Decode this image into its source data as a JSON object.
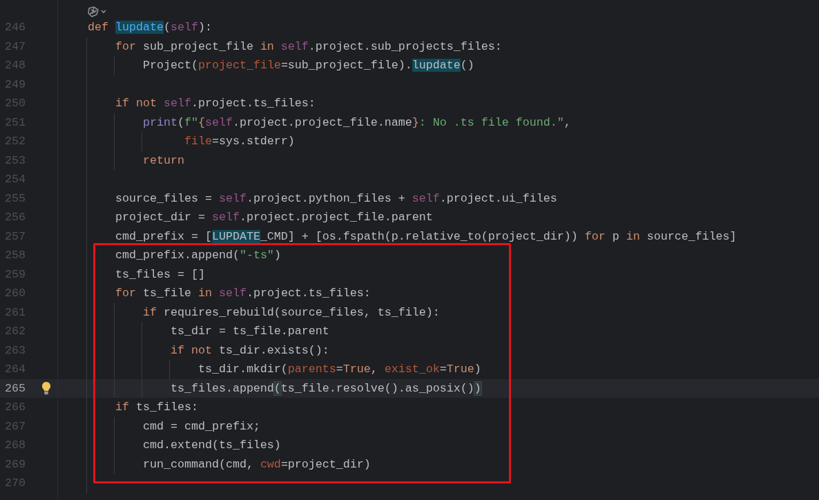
{
  "editor": {
    "lines": [
      {
        "number": "246",
        "current": false,
        "bulb": false,
        "tokens": [
          {
            "text": "    def",
            "kind": "keyword"
          },
          {
            "text": " lupdate",
            "kind": "function",
            "highlighted": true
          },
          {
            "text": "("
          },
          {
            "text": "self",
            "kind": "self"
          },
          {
            "text": "):"
          }
        ]
      },
      {
        "number": "247",
        "current": false,
        "bulb": false,
        "tokens": [
          {
            "text": "        for",
            "kind": "keyword"
          },
          {
            "text": " sub_project_file "
          },
          {
            "text": "in",
            "kind": "keyword"
          },
          {
            "text": " self",
            "kind": "self"
          },
          {
            "text": ".project.sub_projects_files:"
          }
        ]
      },
      {
        "number": "248",
        "current": false,
        "bulb": false,
        "tokens": [
          {
            "text": "            Project("
          },
          {
            "text": "project_file",
            "kind": "param"
          },
          {
            "text": "=sub_project_file)."
          },
          {
            "text": "lupdate",
            "highlighted": true
          },
          {
            "text": "()"
          }
        ]
      },
      {
        "number": "249",
        "current": false,
        "bulb": false
      },
      {
        "number": "250",
        "current": false,
        "bulb": false,
        "tokens": [
          {
            "text": "        if not",
            "kind": "keyword"
          },
          {
            "text": " self",
            "kind": "self"
          },
          {
            "text": ".project.ts_files:"
          }
        ]
      },
      {
        "number": "251",
        "current": false,
        "bulb": false,
        "tokens": [
          {
            "text": "            print",
            "kind": "builtin"
          },
          {
            "text": "("
          },
          {
            "text": "f\"",
            "kind": "string"
          },
          {
            "text": "{",
            "kind": "keyword"
          },
          {
            "text": "self",
            "kind": "self"
          },
          {
            "text": ".project.project_file.name"
          },
          {
            "text": "}",
            "kind": "keyword"
          },
          {
            "text": ": No .ts file found.\"",
            "kind": "string"
          },
          {
            "text": ","
          }
        ]
      },
      {
        "number": "252",
        "current": false,
        "bulb": false,
        "tokens": [
          {
            "text": "                  file",
            "kind": "param"
          },
          {
            "text": "=sys.stderr)"
          }
        ]
      },
      {
        "number": "253",
        "current": false,
        "bulb": false,
        "tokens": [
          {
            "text": "            return",
            "kind": "keyword"
          }
        ]
      },
      {
        "number": "254",
        "current": false,
        "bulb": false
      },
      {
        "number": "255",
        "current": false,
        "bulb": false,
        "tokens": [
          {
            "text": "        source_files = "
          },
          {
            "text": "self",
            "kind": "self"
          },
          {
            "text": ".project.python_files + "
          },
          {
            "text": "self",
            "kind": "self"
          },
          {
            "text": ".project.ui_files"
          }
        ]
      },
      {
        "number": "256",
        "current": false,
        "bulb": false,
        "tokens": [
          {
            "text": "        project_dir = "
          },
          {
            "text": "self",
            "kind": "self"
          },
          {
            "text": ".project.project_file.parent"
          }
        ]
      },
      {
        "number": "257",
        "current": false,
        "bulb": false,
        "tokens": [
          {
            "text": "        cmd_prefix = ["
          },
          {
            "text": "LUPDATE",
            "highlighted": true
          },
          {
            "text": "_CMD] + [os.fspath(p.relative_to(project_dir)) "
          },
          {
            "text": "for",
            "kind": "keyword"
          },
          {
            "text": " p "
          },
          {
            "text": "in",
            "kind": "keyword"
          },
          {
            "text": " source_files]"
          }
        ]
      },
      {
        "number": "258",
        "current": false,
        "bulb": false,
        "tokens": [
          {
            "text": "        cmd_prefix.append("
          },
          {
            "text": "\"-ts\"",
            "kind": "string"
          },
          {
            "text": ")"
          }
        ]
      },
      {
        "number": "259",
        "current": false,
        "bulb": false,
        "tokens": [
          {
            "text": "        ts_files = []"
          }
        ]
      },
      {
        "number": "260",
        "current": false,
        "bulb": false,
        "tokens": [
          {
            "text": "        for",
            "kind": "keyword"
          },
          {
            "text": " ts_file "
          },
          {
            "text": "in",
            "kind": "keyword"
          },
          {
            "text": " self",
            "kind": "self"
          },
          {
            "text": ".project.ts_files:"
          }
        ]
      },
      {
        "number": "261",
        "current": false,
        "bulb": false,
        "tokens": [
          {
            "text": "            if",
            "kind": "keyword"
          },
          {
            "text": " requires_rebuild(source_files, ts_file):"
          }
        ]
      },
      {
        "number": "262",
        "current": false,
        "bulb": false,
        "tokens": [
          {
            "text": "                ts_dir = ts_file.parent"
          }
        ]
      },
      {
        "number": "263",
        "current": false,
        "bulb": false,
        "tokens": [
          {
            "text": "                if not",
            "kind": "keyword"
          },
          {
            "text": " ts_dir.exists():"
          }
        ]
      },
      {
        "number": "264",
        "current": false,
        "bulb": false,
        "tokens": [
          {
            "text": "                    ts_dir.mkdir("
          },
          {
            "text": "parents",
            "kind": "param"
          },
          {
            "text": "="
          },
          {
            "text": "True",
            "kind": "keyword"
          },
          {
            "text": ", "
          },
          {
            "text": "exist_ok",
            "kind": "param"
          },
          {
            "text": "="
          },
          {
            "text": "True",
            "kind": "keyword"
          },
          {
            "text": ")"
          }
        ]
      },
      {
        "number": "265",
        "current": true,
        "bulb": true,
        "tokens": [
          {
            "text": "                ts_files.append"
          },
          {
            "text": "(",
            "kind": "brace",
            "highlighted": true
          },
          {
            "text": "ts_file.resolve().as_posix()"
          },
          {
            "text": ")",
            "kind": "brace",
            "highlighted": true
          }
        ]
      },
      {
        "number": "266",
        "current": false,
        "bulb": false,
        "tokens": [
          {
            "text": "        if",
            "kind": "keyword"
          },
          {
            "text": " ts_files:"
          }
        ]
      },
      {
        "number": "267",
        "current": false,
        "bulb": false,
        "tokens": [
          {
            "text": "            cmd = cmd_prefix;"
          }
        ]
      },
      {
        "number": "268",
        "current": false,
        "bulb": false,
        "tokens": [
          {
            "text": "            cmd.extend(ts_files)"
          }
        ]
      },
      {
        "number": "269",
        "current": false,
        "bulb": false,
        "tokens": [
          {
            "text": "            run_command(cmd, "
          },
          {
            "text": "cwd",
            "kind": "param"
          },
          {
            "text": "=project_dir)"
          }
        ]
      },
      {
        "number": "270",
        "current": false,
        "bulb": false
      }
    ]
  }
}
